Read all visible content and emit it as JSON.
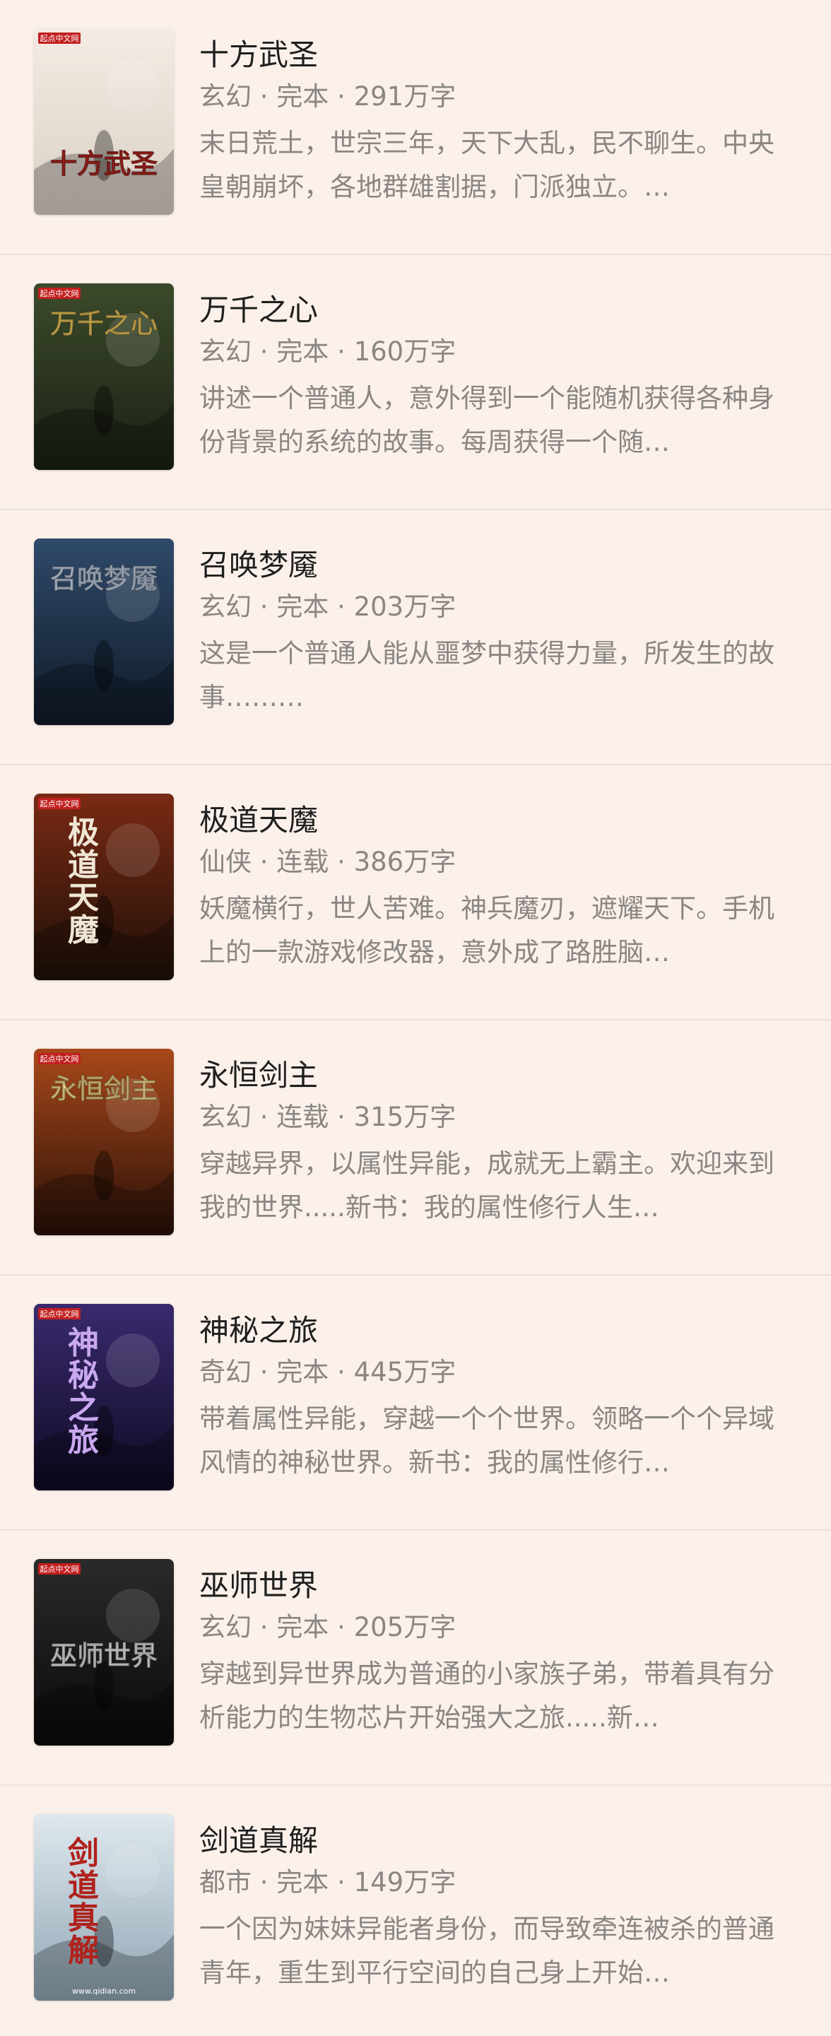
{
  "books": [
    {
      "title": "十方武圣",
      "meta": "玄幻 · 完本 · 291万字",
      "description": "末日荒土，世宗三年，天下大乱，民不聊生。中央皇朝崩坏，各地群雄割据，门派独立。…",
      "cover": {
        "bg1": "#f4ece4",
        "bg2": "#d9cfc4",
        "accent": "#b0221c",
        "cover_text": "十方武圣",
        "badge": "起点中文网"
      }
    },
    {
      "title": "万千之心",
      "meta": "玄幻 · 完本 · 160万字",
      "description": "讲述一个普通人，意外得到一个能随机获得各种身份背景的系统的故事。每周获得一个随…",
      "cover": {
        "bg1": "#3c4a2a",
        "bg2": "#1a2015",
        "accent": "#e8c35a",
        "cover_text": "万千之心",
        "badge": "起点中文网"
      }
    },
    {
      "title": "召唤梦魇",
      "meta": "玄幻 · 完本 · 203万字",
      "description": "这是一个普通人能从噩梦中获得力量，所发生的故事………",
      "cover": {
        "bg1": "#2f4a6a",
        "bg2": "#101a28",
        "accent": "#c8d4e6",
        "cover_text": "召唤梦魇",
        "badge": ""
      }
    },
    {
      "title": "极道天魔",
      "meta": "仙侠 · 连载 · 386万字",
      "description": "妖魔横行，世人苦难。神兵魔刃，遮耀天下。手机上的一款游戏修改器，意外成了路胜脑…",
      "cover": {
        "bg1": "#7a2a14",
        "bg2": "#1e1008",
        "accent": "#f0e6d6",
        "cover_text": "极道天魔",
        "badge": "起点中文网"
      }
    },
    {
      "title": "永恒剑主",
      "meta": "玄幻 · 连载 · 315万字",
      "description": "穿越异界，以属性异能，成就无上霸主。欢迎来到我的世界.....新书：我的属性修行人生…",
      "cover": {
        "bg1": "#a8481a",
        "bg2": "#2a1008",
        "accent": "#f6dc8c",
        "cover_text": "永恒剑主",
        "badge": "起点中文网"
      }
    },
    {
      "title": "神秘之旅",
      "meta": "奇幻 · 完本 · 445万字",
      "description": "带着属性异能，穿越一个个世界。领略一个个异域风情的神秘世界。新书：我的属性修行…",
      "cover": {
        "bg1": "#3a2a6e",
        "bg2": "#0e0a22",
        "accent": "#c9a8f0",
        "cover_text": "神秘之旅",
        "badge": "起点中文网"
      }
    },
    {
      "title": "巫师世界",
      "meta": "玄幻 · 完本 · 205万字",
      "description": "穿越到异世界成为普通的小家族子弟，带着具有分析能力的生物芯片开始强大之旅.....新…",
      "cover": {
        "bg1": "#2a2a2a",
        "bg2": "#0a0a0a",
        "accent": "#e6e6e6",
        "cover_text": "巫师世界",
        "badge": "起点中文网"
      }
    },
    {
      "title": "剑道真解",
      "meta": "都市 · 完本 · 149万字",
      "description": "一个因为妹妹异能者身份，而导致牵连被杀的普通青年，重生到平行空间的自己身上开始…",
      "cover": {
        "bg1": "#dfe8ee",
        "bg2": "#8fa6b4",
        "accent": "#b0221c",
        "cover_text": "剑道真解",
        "badge": "www.qidian.com"
      }
    }
  ]
}
